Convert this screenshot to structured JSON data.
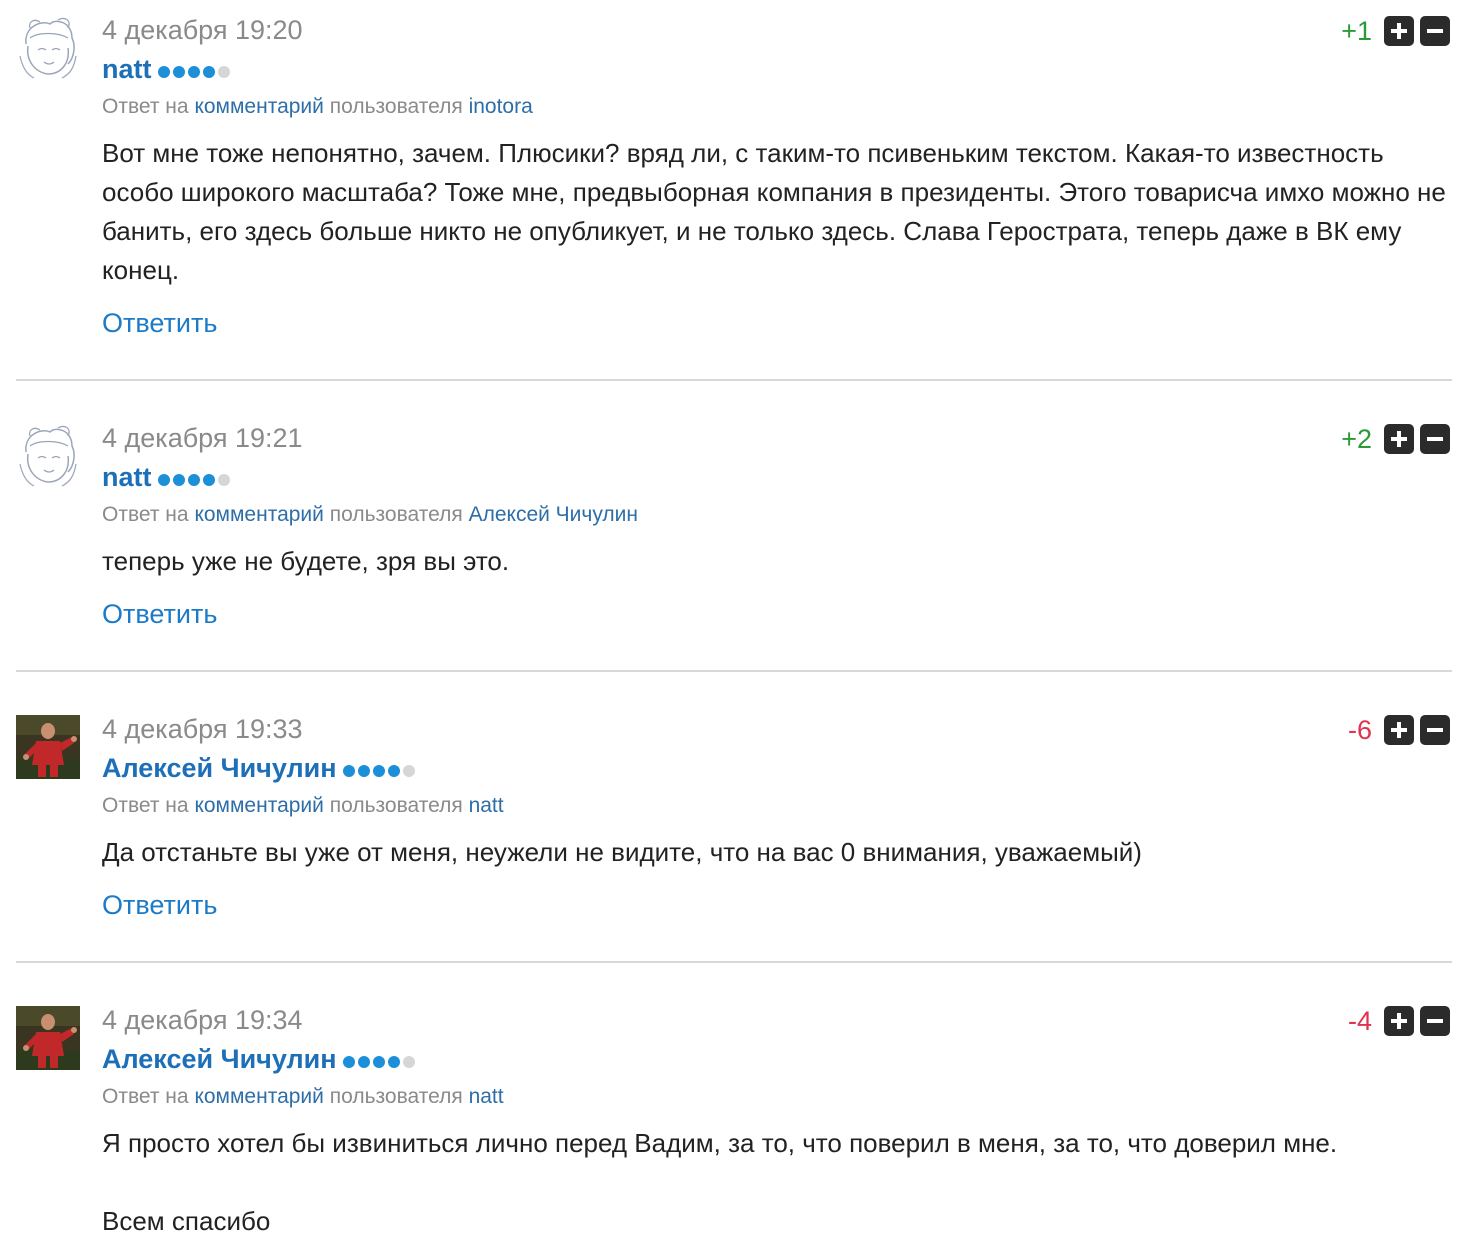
{
  "reply_label": "Ответить",
  "reply_prefix": "Ответ на",
  "reply_comment_link": "комментарий",
  "reply_user_word": "пользователя",
  "comments": [
    {
      "date": "4 декабря 19:20",
      "author": "natt",
      "reply_to_user": "inotora",
      "score": "+1",
      "text": "Вот мне тоже непонятно, зачем. Плюсики? вряд ли, с таким-то псивеньким текстом. Какая-то известность особо широкого масштаба? Тоже мне, предвыборная компания в президенты. Этого товарисча имхо можно не банить, его здесь больше никто не опубликует, и не только здесь. Слава Герострата, теперь даже в ВК ему конец."
    },
    {
      "date": "4 декабря 19:21",
      "author": "natt",
      "reply_to_user": "Алексей Чичулин",
      "score": "+2",
      "text": "теперь уже не будете, зря вы это."
    },
    {
      "date": "4 декабря 19:33",
      "author": "Алексей Чичулин",
      "reply_to_user": "natt",
      "score": "-6",
      "text": "Да отстаньте вы уже от меня, неужели не видите, что на вас 0 внимания, уважаемый)"
    },
    {
      "date": "4 декабря 19:34",
      "author": "Алексей Чичулин",
      "reply_to_user": "natt",
      "score": "-4",
      "text": "Я просто хотел бы извиниться лично перед Вадим, за то, что поверил в меня, за то, что доверил мне.",
      "text2": "Всем спасибо"
    }
  ],
  "colors": {
    "link": "#1d7ac7",
    "author": "#1d6fb8",
    "positive": "#2a9a3a",
    "negative": "#e0334d",
    "meta": "#8a8a8a"
  },
  "icons": {
    "upvote": "plus-icon",
    "downvote": "minus-icon",
    "avatar_natt": "cartoon-girl-avatar",
    "avatar_alexey": "football-player-photo-avatar"
  }
}
